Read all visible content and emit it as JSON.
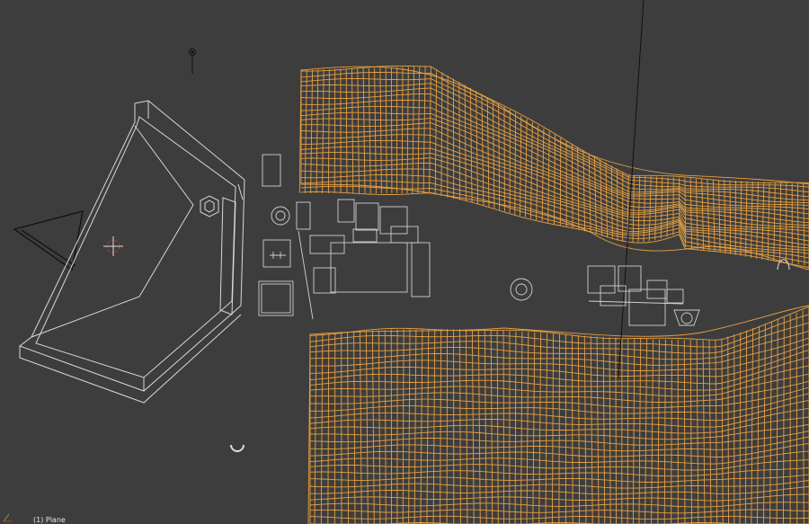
{
  "viewport": {
    "object_label": "(1) Plane"
  },
  "colors": {
    "background": "#3d3d3d",
    "selected_wire": "#f0a030",
    "unselected_wire": "#d8d8d8",
    "black_wire": "#000000",
    "cursor": "#c83232"
  },
  "icons": {
    "camera": "camera-icon",
    "lamp": "lamp-icon",
    "cursor": "3d-cursor-icon",
    "gizmo": "axis-gizmo-icon"
  }
}
